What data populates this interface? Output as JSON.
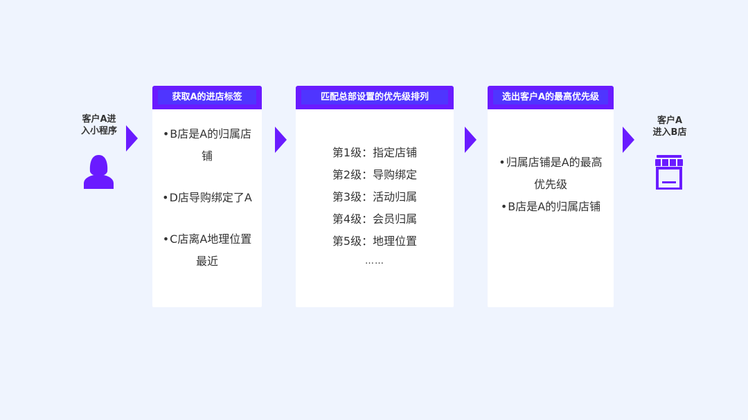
{
  "colors": {
    "background": "#eff4fe",
    "accent": "#6a1bff",
    "header_inner": "#4f35ff",
    "card": "#ffffff",
    "text": "#333333"
  },
  "start": {
    "label": "客户A进\n入小程序",
    "icon": "user-icon"
  },
  "end": {
    "label": "客户A\n进入B店",
    "icon": "store-icon"
  },
  "cards": [
    {
      "title": "获取A的进店标签",
      "bullets": [
        {
          "dot": "•",
          "text": "B店是A的归属店铺"
        },
        {
          "dot": "•",
          "text": "D店导购绑定了A"
        },
        {
          "dot": "•",
          "text": "C店离A地理位置最近"
        }
      ]
    },
    {
      "title": "匹配总部设置的优先级排列",
      "levels": [
        {
          "label": "第1级：",
          "value": "指定店铺"
        },
        {
          "label": "第2级：",
          "value": "导购绑定"
        },
        {
          "label": "第3级：",
          "value": "活动归属"
        },
        {
          "label": "第4级：",
          "value": "会员归属"
        },
        {
          "label": "第5级：",
          "value": "地理位置"
        }
      ],
      "more": "……"
    },
    {
      "title": "选出客户A的最高优先级",
      "bullets": [
        {
          "dot": "•",
          "text": "归属店铺是A的最高优先级"
        },
        {
          "dot": "•",
          "text": "B店是A的归属店铺"
        }
      ]
    }
  ]
}
